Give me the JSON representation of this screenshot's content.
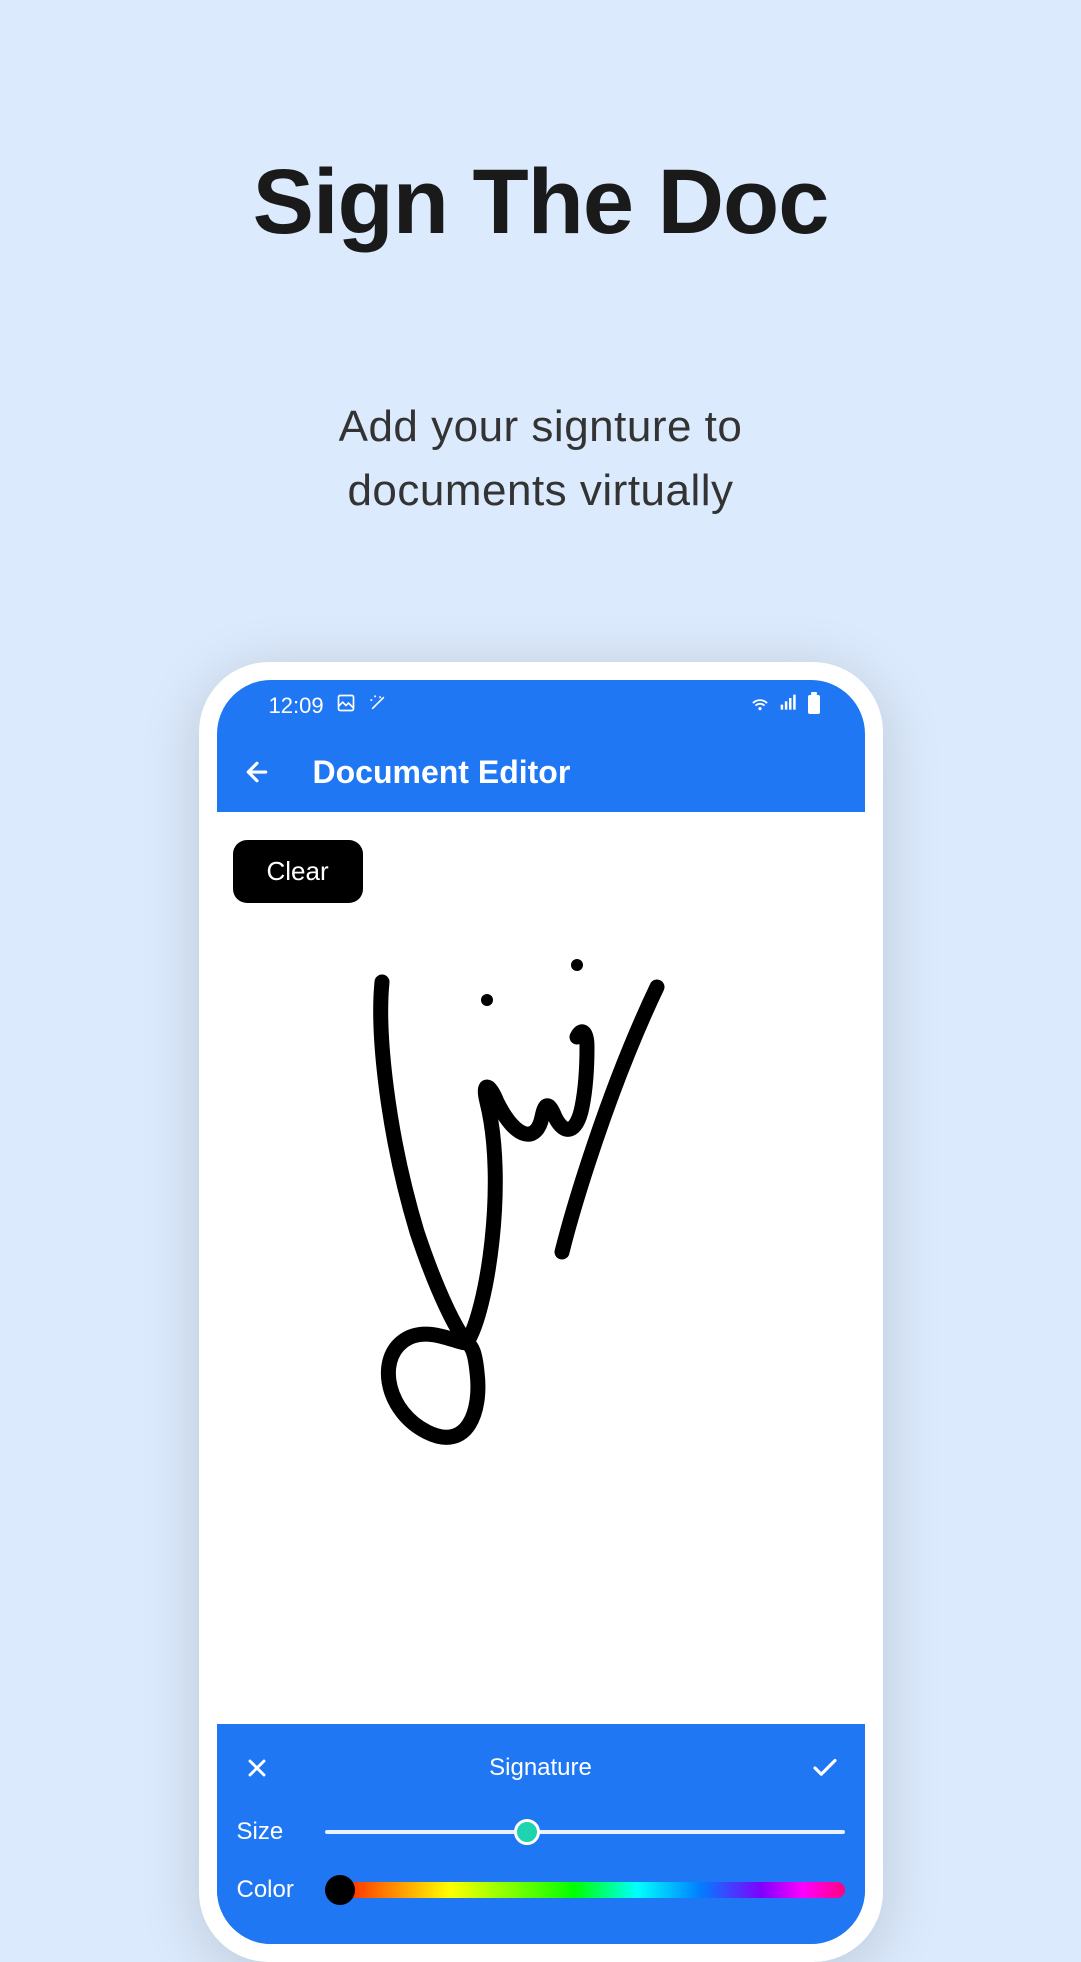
{
  "promo": {
    "title": "Sign The Doc",
    "subtitle_line1": "Add your signture to",
    "subtitle_line2": "documents virtually"
  },
  "status_bar": {
    "time": "12:09"
  },
  "app_bar": {
    "title": "Document Editor"
  },
  "canvas": {
    "clear_button": "Clear"
  },
  "panel": {
    "title": "Signature",
    "size_label": "Size",
    "color_label": "Color",
    "size_value": 39,
    "color_value": "#000000"
  }
}
